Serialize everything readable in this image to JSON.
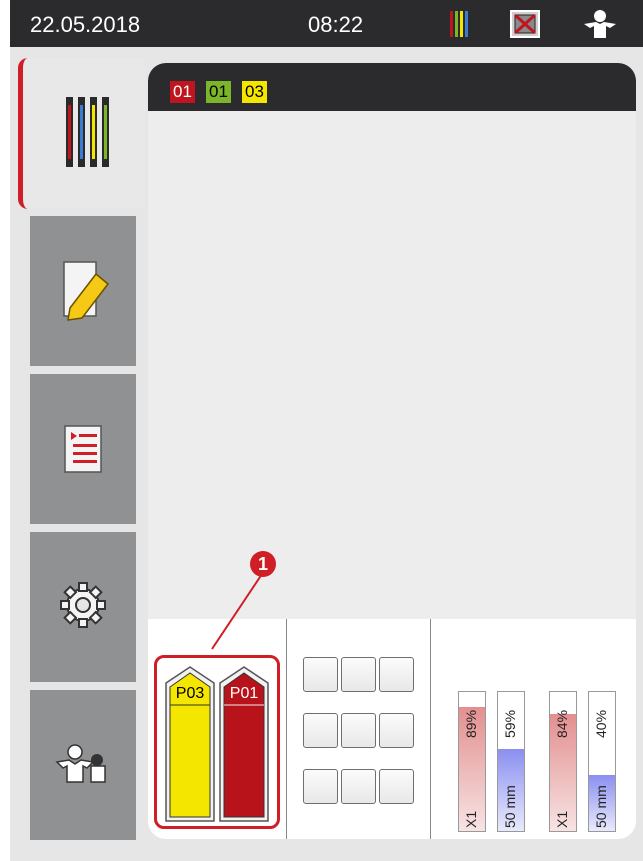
{
  "status_bar": {
    "date": "22.05.2018",
    "time": "08:22",
    "icons": [
      "reagent-racks-icon",
      "no-connection-icon",
      "user-icon"
    ]
  },
  "sidebar": {
    "tabs": [
      {
        "name": "tab-status",
        "icon": "reagent-racks-icon",
        "active": true
      },
      {
        "name": "tab-program-list",
        "icon": "notepad-edit-icon",
        "active": false
      },
      {
        "name": "tab-reagent-list",
        "icon": "list-icon",
        "active": false
      },
      {
        "name": "tab-settings",
        "icon": "gear-icon",
        "active": false
      },
      {
        "name": "tab-user",
        "icon": "user-settings-icon",
        "active": false
      }
    ]
  },
  "header": {
    "chips": [
      {
        "label": "01",
        "color": "#c0151e"
      },
      {
        "label": "01",
        "color": "#7ab52a"
      },
      {
        "label": "03",
        "color": "#f5e600"
      }
    ]
  },
  "callout": {
    "number": "1"
  },
  "drawers": [
    {
      "label": "P03",
      "color": "#f5e600",
      "text_color": "#000000"
    },
    {
      "label": "P01",
      "color": "#b8131a",
      "text_color": "#ffffff"
    }
  ],
  "fill_levels": [
    {
      "type": "X1",
      "percent": "89%",
      "fill_color": "#e38f8f"
    },
    {
      "type": "50 mm",
      "percent": "59%",
      "fill_color": "#8a8ff0"
    },
    {
      "type": "X1",
      "percent": "84%",
      "fill_color": "#e38f8f"
    },
    {
      "type": "50 mm",
      "percent": "40%",
      "fill_color": "#8a8ff0"
    }
  ],
  "slots": {
    "rows": 3,
    "cols": 3
  }
}
